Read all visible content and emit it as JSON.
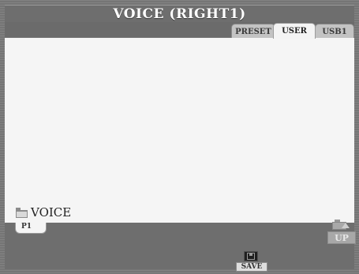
{
  "window": {
    "title": "VOICE (RIGHT1)"
  },
  "tabs": [
    {
      "label": "PRESET",
      "selected": false
    },
    {
      "label": "USER",
      "selected": true
    },
    {
      "label": "USB1",
      "selected": false
    }
  ],
  "folder": {
    "label": "VOICE",
    "icon": "folder-icon"
  },
  "page_tabs": [
    {
      "label": "P1",
      "selected": true
    }
  ],
  "buttons": {
    "up_label": "UP",
    "up_icon": "folder-up-icon",
    "save_label": "SAVE",
    "save_icon": "floppy-disk-icon"
  },
  "colors": {
    "frame": "#7a7a7a",
    "content_bg": "#f5f5f5",
    "tab_selected": "#f4f4f4",
    "tab_unselected": "#c3c3c3"
  }
}
